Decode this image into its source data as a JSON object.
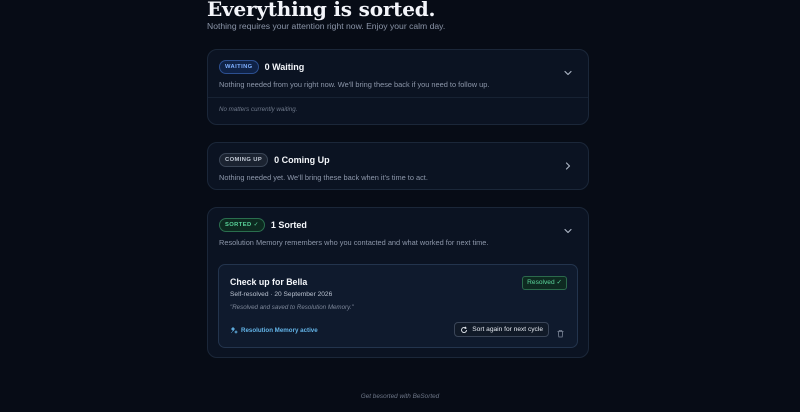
{
  "hero": {
    "title": "Everything is sorted.",
    "subtitle": "Nothing requires your attention right now. Enjoy your calm day."
  },
  "sections": {
    "waiting": {
      "badge": "WAITING",
      "title": "0 Waiting",
      "description": "Nothing needed from you right now. We'll bring these back if you need to follow up.",
      "empty_note": "No matters currently waiting.",
      "chevron": "chevron-down-icon"
    },
    "coming_up": {
      "badge": "COMING UP",
      "title": "0 Coming Up",
      "description": "Nothing needed yet. We'll bring these back when it's time to act.",
      "chevron": "chevron-right-icon"
    },
    "sorted": {
      "badge": "SORTED ✓",
      "title": "1 Sorted",
      "description": "Resolution Memory remembers who you contacted and what worked for next time.",
      "chevron": "chevron-down-icon",
      "item": {
        "title": "Check up for Bella",
        "meta": "Self-resolved · 20 September 2026",
        "quote": "\"Resolved and saved to Resolution Memory.\"",
        "status": "Resolved ✓",
        "memory_label": "Resolution Memory active",
        "action_label": "Sort again for next cycle"
      }
    }
  },
  "footer": {
    "text": "Get besorted with BeSorted"
  },
  "colors": {
    "background": "#070c16",
    "card": "#0b1322",
    "waiting_accent": "#7fb0ff",
    "sorted_accent": "#59d49a",
    "link_accent": "#63b4e8"
  }
}
